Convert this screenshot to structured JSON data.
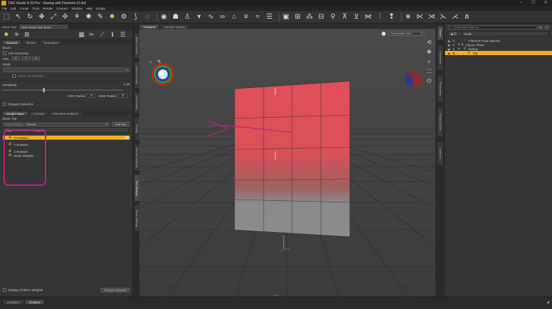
{
  "window": {
    "title": "DAZ Studio 4.20 Pro - Startup with Filament v2.duf",
    "controls": [
      "–",
      "☐",
      "✕"
    ]
  },
  "menu": [
    "File",
    "Edit",
    "Create",
    "Tools",
    "Render",
    "Connect",
    "Window",
    "Help",
    "Scripts"
  ],
  "toolbar": {
    "icons": [
      "select-icon",
      "pointer-icon",
      "rotate-icon",
      "translate-icon",
      "scale-icon",
      "universal-icon",
      "node-weight-icon",
      "joint-editor-icon",
      "map-brush-icon",
      "surface-icon",
      "geometry-icon",
      "magnet-icon",
      "eye-icon",
      "figure-icon",
      "hat-icon",
      "hair-icon",
      "prop-icon",
      "light-icon",
      "camera-icon",
      "render-icon",
      "settings-icon",
      "grid-icon",
      "shelf-icon",
      "bone-icon",
      "weight-icon",
      "transfer-icon",
      "morph-icon",
      "toggle-icon",
      "info-icon"
    ]
  },
  "left_panel": {
    "active_tool_label": "Active Tool",
    "active_tool_value": "Node Weight Map Brush",
    "tabs": [
      "General",
      "Stroke",
      "Normalize"
    ],
    "brush_label": "Brush",
    "use_symmetry": "Use Symmetry",
    "axis_label": "Axis",
    "axis_options": [
      "X",
      "Y",
      "Z"
    ],
    "mode_label": "Mode",
    "mode_sub": "Mode Constrained",
    "sensitivity_label": "Sensitivity",
    "sensitivity_value": "0.36",
    "inner_radius_label": "Inner Radius",
    "inner_radius_value": "10",
    "outer_radius_label": "Outer Radius",
    "outer_radius_value": "40",
    "respect_selection": "Respect Selection",
    "map_tabs": [
      "Weight Maps",
      "Locking",
      "Selection Analysis"
    ],
    "bone_label": "Bone: Top",
    "map_type": "General",
    "map_type_label": "Figure Rigging",
    "add_map": "Add Map",
    "col_map": "Map",
    "col_property": "Property",
    "maps": [
      {
        "label": "X Rotation",
        "selected": true
      },
      {
        "label": "Y Rotation",
        "selected": false
      },
      {
        "label": "Z Rotation",
        "selected": false
      },
      {
        "label": "Scale Weights",
        "selected": false
      }
    ],
    "display_children": "Display Children Weights",
    "remove_selected": "Remove Selected"
  },
  "left_vtabs": [
    {
      "label": "Smart Content",
      "active": false
    },
    {
      "label": "Content Library",
      "active": false
    },
    {
      "label": "Parameters",
      "active": false
    },
    {
      "label": "Posing",
      "active": false
    },
    {
      "label": "Render Settings",
      "active": false
    },
    {
      "label": "Tool Settings",
      "active": true
    },
    {
      "label": "Draw Settings",
      "active": false
    }
  ],
  "viewport": {
    "tabs": [
      "Viewport",
      "Render Library"
    ],
    "camera": "Perspective View",
    "bottom_label": "Pose"
  },
  "right_vtabs": [
    "Scene",
    "Properties",
    "Parameters",
    "Shaping Editor",
    "Surfaces"
  ],
  "right_panel": {
    "search_placeholder": "Enter text to filter by...",
    "col_node": "Node",
    "tree": [
      {
        "label": "Filament Draw Options",
        "indent": 1,
        "selected": false
      },
      {
        "label": "Figure: Plane",
        "indent": 1,
        "selected": false
      },
      {
        "label": "Bottom",
        "indent": 2,
        "selected": false
      },
      {
        "label": "Top",
        "indent": 3,
        "selected": true
      }
    ]
  },
  "status": {
    "tabs": [
      "aniMate2",
      "Timeline"
    ]
  },
  "annotation": {
    "color": "#c0207a"
  }
}
